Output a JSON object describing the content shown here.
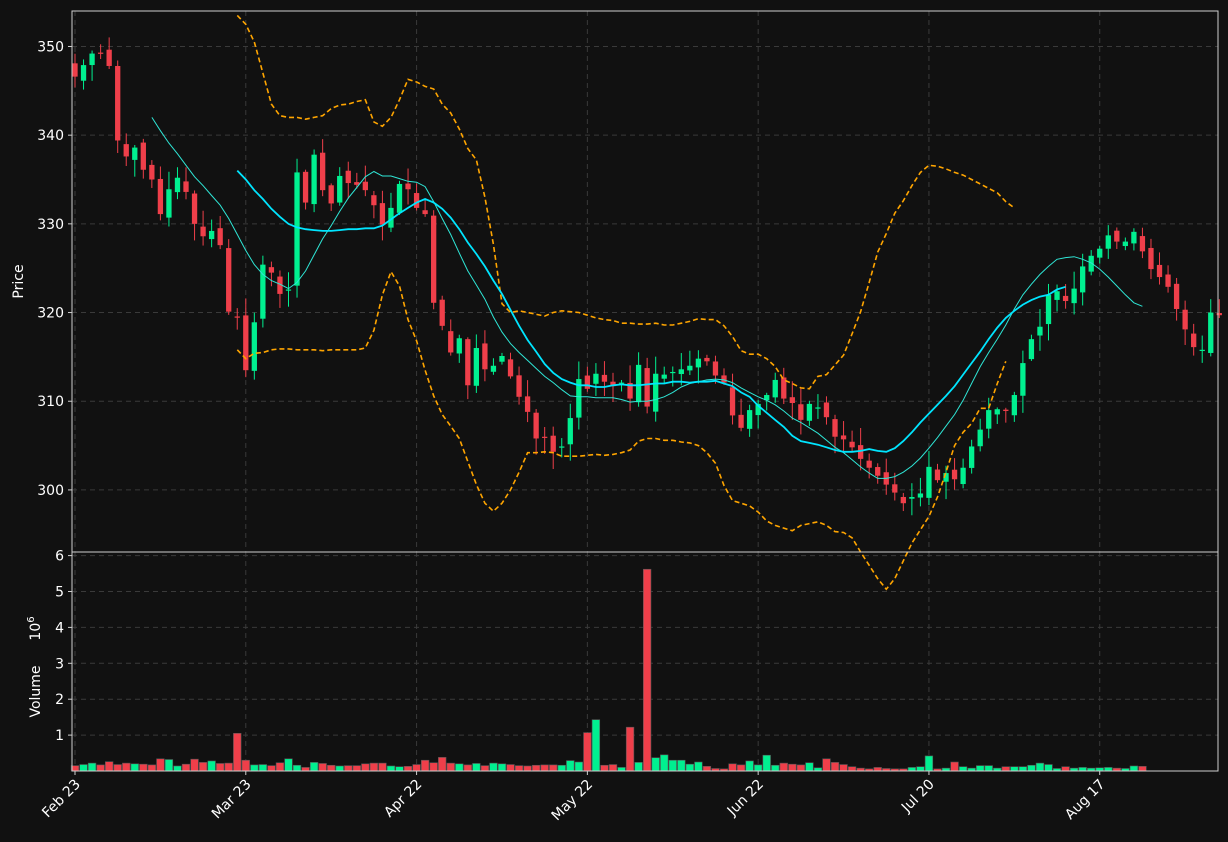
{
  "colors": {
    "background": "#111111",
    "up": "#00f090",
    "down": "#ef3f4a",
    "ma_fast": "#2fe6d6",
    "ma_slow": "#00e5ff",
    "bands": "#ffa500",
    "grid": "#3a3a3a",
    "text": "#ffffff"
  },
  "chart_data": [
    {
      "type": "candlestick",
      "panel": "price",
      "ylabel": "Price",
      "ylim": [
        293,
        354
      ],
      "yticks": [
        300,
        310,
        320,
        330,
        340,
        350
      ],
      "xtick_labels": [
        {
          "i": 0,
          "label": "Feb 23"
        },
        {
          "i": 20,
          "label": "Mar 23"
        },
        {
          "i": 40,
          "label": "Apr 22"
        },
        {
          "i": 60,
          "label": "May 22"
        },
        {
          "i": 80,
          "label": "Jun 22"
        },
        {
          "i": 100,
          "label": "Jul 20"
        },
        {
          "i": 120,
          "label": "Aug 17"
        }
      ],
      "grid": true,
      "close": [
        346.6,
        347.9,
        349.2,
        349.3,
        347.8,
        339.4,
        337.6,
        338.6,
        336.1,
        335.0,
        331.1,
        333.9,
        335.2,
        333.6,
        330.0,
        328.6,
        329.2,
        327.6,
        320.1,
        319.5,
        313.5,
        318.9,
        325.4,
        324.5,
        322.1,
        322.6,
        335.8,
        332.4,
        337.8,
        333.8,
        332.3,
        335.4,
        334.6,
        334.4,
        333.8,
        332.1,
        329.9,
        331.8,
        334.5,
        333.9,
        331.8,
        331.1,
        321.1,
        318.5,
        315.5,
        317.1,
        311.8,
        316.0,
        313.6,
        314.0,
        315.1,
        312.8,
        310.5,
        308.8,
        305.8,
        305.9,
        304.3,
        304.9,
        308.1,
        312.5,
        311.4,
        313.1,
        312.2,
        311.7,
        312.1,
        310.3,
        314.1,
        309.4,
        313.1,
        313.0,
        313.3,
        313.6,
        314.0,
        314.8,
        314.5,
        312.9,
        312.1,
        308.4,
        307.0,
        309.0,
        309.7,
        310.7,
        312.4,
        310.3,
        309.8,
        307.9,
        309.7,
        309.3,
        308.2,
        306.0,
        305.7,
        304.8,
        303.5,
        302.5,
        301.6,
        300.6,
        299.7,
        298.5,
        299.2,
        299.6,
        302.6,
        301.1,
        301.9,
        301.2,
        302.5,
        304.9,
        306.8,
        309.0,
        309.1,
        308.9,
        310.7,
        314.3,
        317.0,
        318.4,
        322.0,
        322.4,
        321.3,
        322.7,
        325.2,
        326.4,
        327.2,
        328.7,
        328.0,
        328.0,
        329.1,
        326.9,
        324.9,
        324.0,
        322.9,
        320.4,
        318.1,
        316.1,
        315.8,
        320.0,
        319.7
      ],
      "ma_fast": [
        null,
        null,
        null,
        null,
        null,
        null,
        null,
        null,
        null,
        342.0,
        340.5,
        339.1,
        337.9,
        336.6,
        335.3,
        334.3,
        333.2,
        332.1,
        330.6,
        328.8,
        327.0,
        325.4,
        324.3,
        323.6,
        323.2,
        322.7,
        323.4,
        324.7,
        326.5,
        328.3,
        329.8,
        331.4,
        332.9,
        334.1,
        335.3,
        335.9,
        335.4,
        335.4,
        335.1,
        334.8,
        334.7,
        334.2,
        332.5,
        330.6,
        328.8,
        326.7,
        324.7,
        323.1,
        321.5,
        319.5,
        317.8,
        316.5,
        315.5,
        314.6,
        313.7,
        312.8,
        312.1,
        311.3,
        310.6,
        310.5,
        310.5,
        310.4,
        310.4,
        310.4,
        310.2,
        309.9,
        310.0,
        310.0,
        310.2,
        310.5,
        311.0,
        311.6,
        312.0,
        312.2,
        312.4,
        312.5,
        312.4,
        312.1,
        311.5,
        311.0,
        310.5,
        310.1,
        309.6,
        308.9,
        308.1,
        307.6,
        307.0,
        306.4,
        305.6,
        304.8,
        304.2,
        303.4,
        302.6,
        301.9,
        301.3,
        301.3,
        301.5,
        302.0,
        302.7,
        303.6,
        304.7,
        305.9,
        307.2,
        308.5,
        310.1,
        312.0,
        313.9,
        315.5,
        317.0,
        318.6,
        320.4,
        322.0,
        323.2,
        324.3,
        325.2,
        326.0,
        326.2,
        326.3,
        326.0,
        325.6,
        324.9,
        324.0,
        323.0,
        322.0,
        321.1,
        320.7
      ],
      "ma_slow": [
        null,
        null,
        null,
        null,
        null,
        null,
        null,
        null,
        null,
        null,
        null,
        null,
        null,
        null,
        null,
        null,
        null,
        null,
        null,
        336.0,
        335.0,
        333.8,
        332.8,
        331.7,
        330.8,
        330.0,
        329.6,
        329.4,
        329.3,
        329.2,
        329.2,
        329.3,
        329.4,
        329.4,
        329.5,
        329.5,
        329.8,
        330.5,
        331.2,
        331.8,
        332.4,
        332.8,
        332.4,
        331.7,
        330.7,
        329.4,
        327.9,
        326.6,
        325.2,
        323.6,
        322.1,
        320.3,
        318.5,
        316.9,
        315.6,
        314.2,
        313.2,
        312.5,
        312.1,
        311.8,
        311.8,
        311.6,
        311.6,
        311.8,
        311.9,
        311.8,
        311.8,
        311.9,
        312.0,
        312.0,
        312.2,
        312.2,
        312.1,
        312.2,
        312.2,
        312.3,
        312.0,
        311.7,
        311.0,
        310.5,
        309.5,
        308.7,
        307.9,
        307.1,
        306.1,
        305.5,
        305.3,
        305.1,
        304.8,
        304.5,
        304.3,
        304.3,
        304.4,
        304.6,
        304.4,
        304.3,
        304.7,
        305.5,
        306.5,
        307.6,
        308.6,
        309.6,
        310.6,
        311.7,
        313.0,
        314.3,
        315.6,
        317.0,
        318.3,
        319.4,
        320.2,
        320.9,
        321.4,
        321.8,
        322.0,
        322.6,
        322.9
      ],
      "band_upper": [
        null,
        null,
        null,
        null,
        null,
        null,
        null,
        null,
        null,
        null,
        null,
        null,
        null,
        null,
        null,
        null,
        null,
        null,
        null,
        353.5,
        352.5,
        350.5,
        347.0,
        343.5,
        342.2,
        342.0,
        342.0,
        341.8,
        342.0,
        342.2,
        343.0,
        343.4,
        343.5,
        343.8,
        344.0,
        341.5,
        341.0,
        342.0,
        344.0,
        346.3,
        346.0,
        345.5,
        345.2,
        343.5,
        342.5,
        340.7,
        338.5,
        337.2,
        333.0,
        327.7,
        321.0,
        320.0,
        320.2,
        320.0,
        319.8,
        319.6,
        320.0,
        320.2,
        320.1,
        320.0,
        319.7,
        319.4,
        319.2,
        319.1,
        318.8,
        318.8,
        318.7,
        318.7,
        318.8,
        318.6,
        318.6,
        318.8,
        319.0,
        319.3,
        319.2,
        319.2,
        318.5,
        317.3,
        315.7,
        315.3,
        315.3,
        314.8,
        313.9,
        312.4,
        312.0,
        311.5,
        311.4,
        312.8,
        313.0,
        314.1,
        315.2,
        317.6,
        320.1,
        323.4,
        326.8,
        328.9,
        331.2,
        332.6,
        334.3,
        335.8,
        336.6,
        336.5,
        336.2,
        335.8,
        335.5,
        335.0,
        334.5,
        334.0,
        333.5,
        332.5,
        331.8
      ],
      "band_lower": [
        null,
        null,
        null,
        null,
        null,
        null,
        null,
        null,
        null,
        null,
        null,
        null,
        null,
        null,
        null,
        null,
        null,
        null,
        null,
        315.8,
        314.8,
        315.4,
        315.5,
        315.8,
        315.9,
        315.9,
        315.8,
        315.8,
        315.8,
        315.7,
        315.8,
        315.8,
        315.8,
        315.8,
        316.0,
        318.0,
        322.0,
        324.6,
        323.0,
        319.2,
        316.8,
        313.5,
        310.6,
        308.5,
        307.2,
        305.8,
        303.2,
        300.6,
        298.5,
        297.6,
        298.5,
        300.0,
        302.0,
        304.2,
        304.2,
        304.3,
        304.2,
        303.8,
        303.8,
        303.8,
        303.9,
        304.0,
        303.9,
        304.0,
        304.2,
        304.5,
        305.5,
        305.8,
        305.8,
        305.6,
        305.6,
        305.4,
        305.3,
        305.0,
        304.2,
        303.0,
        300.5,
        298.8,
        298.5,
        298.2,
        297.5,
        296.5,
        296.0,
        295.7,
        295.4,
        296.0,
        296.2,
        296.4,
        296.0,
        295.3,
        295.2,
        294.6,
        293.0,
        291.5,
        290.0,
        288.8,
        290.0,
        292.0,
        294.0,
        295.5,
        297.0,
        299.2,
        302.0,
        305.0,
        306.5,
        307.5,
        309.2,
        309.2,
        312.0,
        314.5
      ]
    },
    {
      "type": "bar",
      "panel": "volume",
      "ylabel": "Volume",
      "yunit": "10^6",
      "ylim": [
        0,
        6.1
      ],
      "yticks": [
        1,
        2,
        3,
        4,
        5,
        6
      ],
      "values": [
        0.15,
        0.18,
        0.22,
        0.17,
        0.26,
        0.18,
        0.22,
        0.2,
        0.19,
        0.17,
        0.34,
        0.32,
        0.14,
        0.19,
        0.33,
        0.24,
        0.28,
        0.21,
        0.22,
        1.05,
        0.3,
        0.17,
        0.18,
        0.15,
        0.23,
        0.34,
        0.16,
        0.1,
        0.24,
        0.21,
        0.16,
        0.14,
        0.15,
        0.15,
        0.2,
        0.22,
        0.22,
        0.14,
        0.12,
        0.13,
        0.18,
        0.3,
        0.23,
        0.38,
        0.22,
        0.2,
        0.17,
        0.21,
        0.15,
        0.22,
        0.2,
        0.18,
        0.15,
        0.14,
        0.16,
        0.17,
        0.17,
        0.16,
        0.29,
        0.25,
        1.07,
        1.43,
        0.16,
        0.18,
        0.1,
        1.22,
        0.24,
        5.62,
        0.37,
        0.45,
        0.3,
        0.3,
        0.19,
        0.25,
        0.13,
        0.07,
        0.06,
        0.2,
        0.17,
        0.28,
        0.17,
        0.44,
        0.16,
        0.22,
        0.19,
        0.17,
        0.23,
        0.09,
        0.34,
        0.24,
        0.18,
        0.12,
        0.08,
        0.06,
        0.1,
        0.07,
        0.06,
        0.06,
        0.1,
        0.12,
        0.42,
        0.06,
        0.08,
        0.25,
        0.12,
        0.08,
        0.15,
        0.15,
        0.08,
        0.12,
        0.12,
        0.12,
        0.16,
        0.22,
        0.18,
        0.07,
        0.12,
        0.08,
        0.1,
        0.08,
        0.09,
        0.1,
        0.08,
        0.07,
        0.14,
        0.13
      ]
    }
  ]
}
